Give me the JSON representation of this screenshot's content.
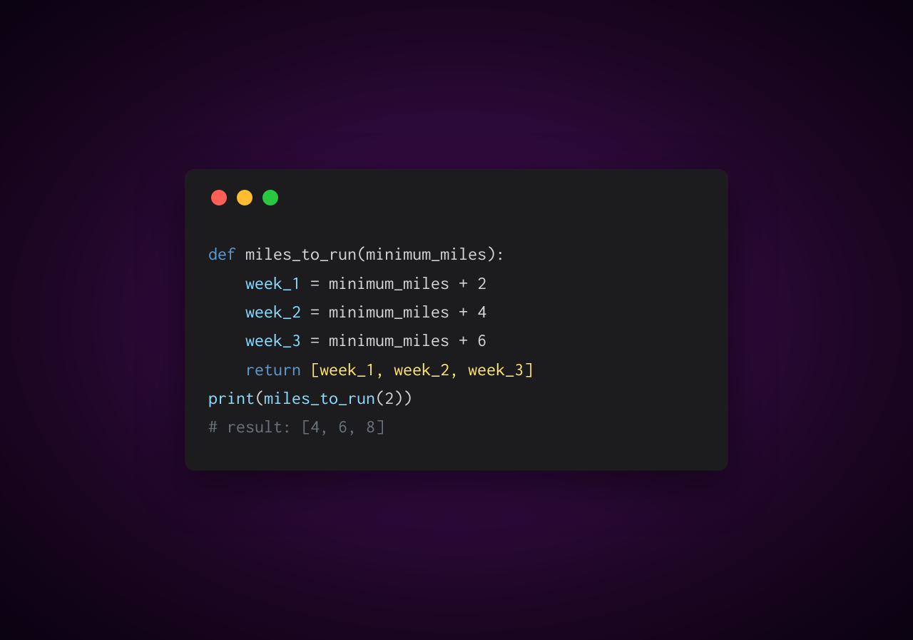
{
  "code": {
    "line1": {
      "def": "def",
      "funcname": "miles_to_run",
      "open": "(",
      "param": "minimum_miles",
      "close": "):"
    },
    "line2": {
      "indent": "    ",
      "var": "week_1",
      "assign": " = ",
      "expr": "minimum_miles + ",
      "num": "2"
    },
    "line3": {
      "indent": "    ",
      "var": "week_2",
      "assign": " = ",
      "expr": "minimum_miles + ",
      "num": "4"
    },
    "line4": {
      "indent": "    ",
      "var": "week_3",
      "assign": " = ",
      "expr": "minimum_miles + ",
      "num": "6"
    },
    "line5": {
      "indent": "    ",
      "ret": "return",
      "space": " ",
      "open": "[",
      "i1": "week_1",
      "c1": ", ",
      "i2": "week_2",
      "c2": ", ",
      "i3": "week_3",
      "close": "]"
    },
    "line6": {
      "print": "print",
      "open": "(",
      "call": "miles_to_run",
      "argopen": "(",
      "arg": "2",
      "argclose": ")",
      "close": ")"
    },
    "line7": {
      "comment": "# result: [4, 6, 8]"
    }
  },
  "traffic": {
    "red": "#ff5f57",
    "yellow": "#febc2e",
    "green": "#28c840"
  }
}
